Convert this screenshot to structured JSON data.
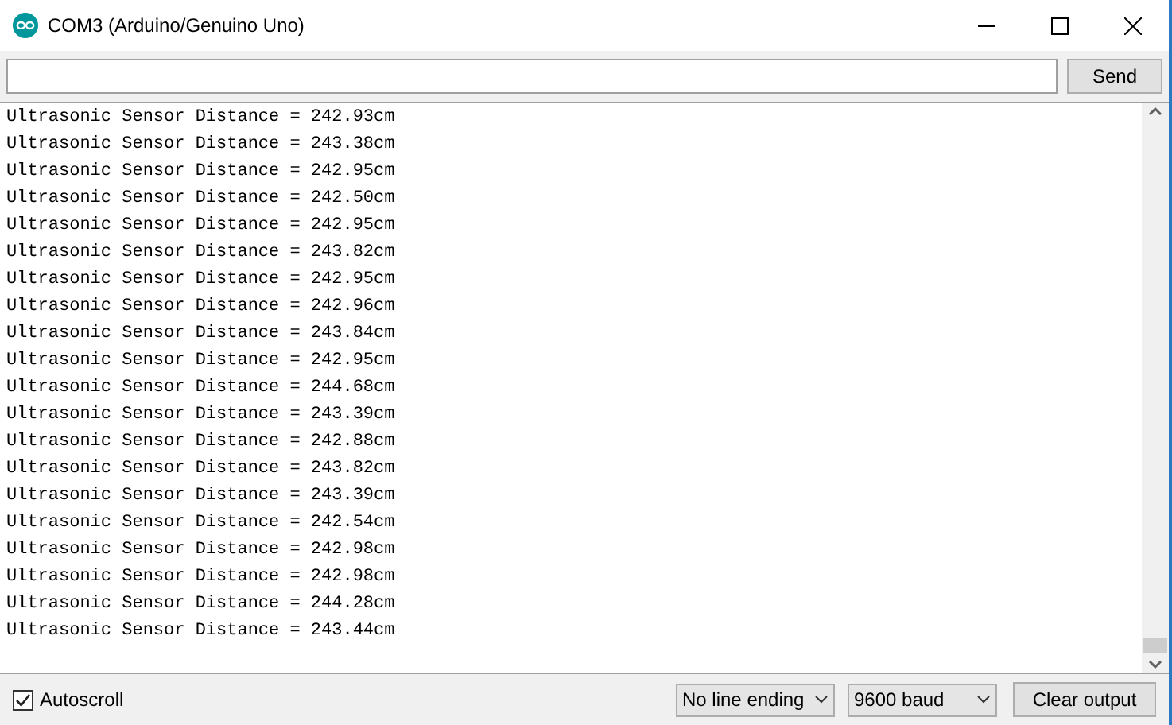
{
  "window": {
    "title": "COM3 (Arduino/Genuino Uno)"
  },
  "send_button": "Send",
  "output_lines": [
    "Ultrasonic Sensor Distance = 242.93cm",
    "Ultrasonic Sensor Distance = 243.38cm",
    "Ultrasonic Sensor Distance = 242.95cm",
    "Ultrasonic Sensor Distance = 242.50cm",
    "Ultrasonic Sensor Distance = 242.95cm",
    "Ultrasonic Sensor Distance = 243.82cm",
    "Ultrasonic Sensor Distance = 242.95cm",
    "Ultrasonic Sensor Distance = 242.96cm",
    "Ultrasonic Sensor Distance = 243.84cm",
    "Ultrasonic Sensor Distance = 242.95cm",
    "Ultrasonic Sensor Distance = 244.68cm",
    "Ultrasonic Sensor Distance = 243.39cm",
    "Ultrasonic Sensor Distance = 242.88cm",
    "Ultrasonic Sensor Distance = 243.82cm",
    "Ultrasonic Sensor Distance = 243.39cm",
    "Ultrasonic Sensor Distance = 242.54cm",
    "Ultrasonic Sensor Distance = 242.98cm",
    "Ultrasonic Sensor Distance = 242.98cm",
    "Ultrasonic Sensor Distance = 244.28cm",
    "Ultrasonic Sensor Distance = 243.44cm"
  ],
  "autoscroll": {
    "label": "Autoscroll",
    "checked": true
  },
  "line_ending": "No line ending",
  "baud": "9600 baud",
  "clear_button": "Clear output"
}
